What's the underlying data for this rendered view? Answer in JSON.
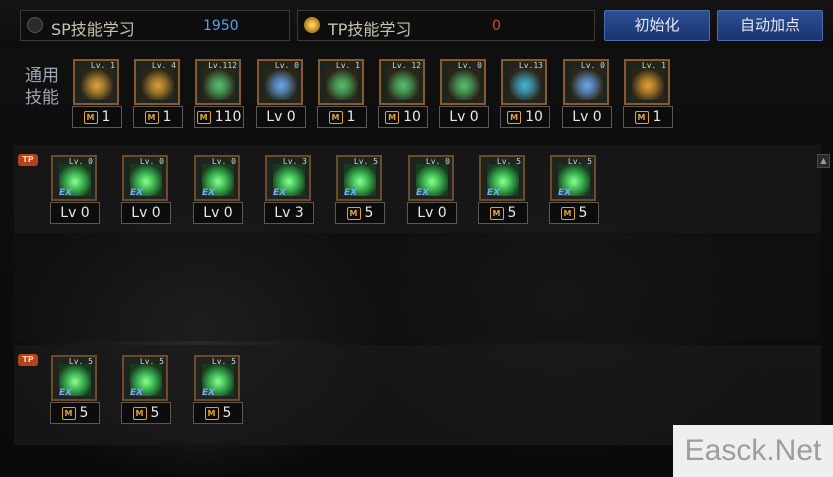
{
  "header": {
    "sp_tab": {
      "label": "SP技能学习",
      "value": "1950"
    },
    "tp_tab": {
      "label": "TP技能学习",
      "value": "0"
    },
    "reset_button": "初始化",
    "auto_button": "自动加点"
  },
  "general_label": [
    "通用",
    "技能"
  ],
  "general_skills": [
    {
      "lv": "Lv. 1",
      "count": "1",
      "badge": true,
      "color": "#e0a23a"
    },
    {
      "lv": "Lv. 4",
      "count": "1",
      "badge": true,
      "color": "#d9a034"
    },
    {
      "lv": "Lv.112",
      "count": "110",
      "badge": true,
      "color": "#56c26a"
    },
    {
      "lv": "Lv. 0",
      "count": "Lv 0",
      "badge": false,
      "color": "#6aa6e8"
    },
    {
      "lv": "Lv. 1",
      "count": "1",
      "badge": true,
      "color": "#56c26a"
    },
    {
      "lv": "Lv. 12",
      "count": "10",
      "badge": true,
      "color": "#56c26a"
    },
    {
      "lv": "Lv. 0",
      "count": "Lv 0",
      "badge": false,
      "color": "#56c26a"
    },
    {
      "lv": "Lv.13",
      "count": "10",
      "badge": true,
      "color": "#46b6d6"
    },
    {
      "lv": "Lv. 0",
      "count": "Lv 0",
      "badge": false,
      "color": "#6aa6e8"
    },
    {
      "lv": "Lv. 1",
      "count": "1",
      "badge": true,
      "color": "#e8a030"
    }
  ],
  "tp_row1": [
    {
      "lv": "Lv. 0",
      "count": "Lv 0",
      "badge": false
    },
    {
      "lv": "Lv. 0",
      "count": "Lv 0",
      "badge": false
    },
    {
      "lv": "Lv. 0",
      "count": "Lv 0",
      "badge": false
    },
    {
      "lv": "Lv. 3",
      "count": "Lv 3",
      "badge": false
    },
    {
      "lv": "Lv. 5",
      "count": "5",
      "badge": true
    },
    {
      "lv": "Lv. 0",
      "count": "Lv 0",
      "badge": false
    },
    {
      "lv": "Lv. 5",
      "count": "5",
      "badge": true
    },
    {
      "lv": "Lv. 5",
      "count": "5",
      "badge": true
    }
  ],
  "tp_row2": [
    {
      "lv": "Lv. 5",
      "count": "5",
      "badge": true
    },
    {
      "lv": "Lv. 5",
      "count": "5",
      "badge": true
    },
    {
      "lv": "Lv. 5",
      "count": "5",
      "badge": true
    }
  ],
  "tp_badge": "TP",
  "ex_mark": "EX",
  "m_mark": "M",
  "watermark": "Easck.Net"
}
